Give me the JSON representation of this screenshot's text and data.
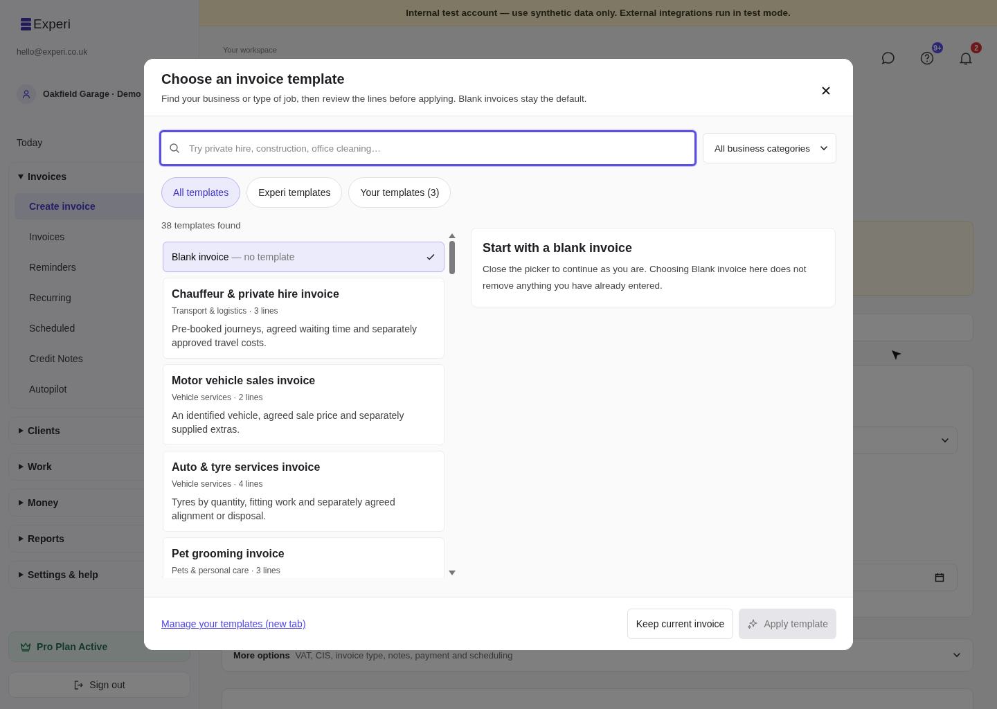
{
  "banner": {
    "text": "Internal test account — use synthetic data only. External integrations run in test mode."
  },
  "sidebar": {
    "logo": "Experi",
    "email": "hello@experi.co.uk",
    "account": "Oakfield Garage · Demo",
    "today": "Today",
    "groups": [
      {
        "label": "Invoices",
        "expanded": true,
        "items": [
          {
            "label": "Create invoice",
            "selected": true
          },
          {
            "label": "Invoices",
            "selected": false
          },
          {
            "label": "Reminders",
            "selected": false
          },
          {
            "label": "Recurring",
            "selected": false
          },
          {
            "label": "Scheduled",
            "selected": false
          },
          {
            "label": "Credit Notes",
            "selected": false
          },
          {
            "label": "Autopilot",
            "selected": false
          }
        ]
      },
      {
        "label": "Clients",
        "expanded": false
      },
      {
        "label": "Work",
        "expanded": false
      },
      {
        "label": "Money",
        "expanded": false
      },
      {
        "label": "Reports",
        "expanded": false
      },
      {
        "label": "Settings & help",
        "expanded": false
      }
    ],
    "plan": "Pro Plan Active",
    "sign_out": "Sign out"
  },
  "header": {
    "workspace": "Your workspace",
    "help_badge": "9+",
    "notifications_badge": "2"
  },
  "more_options": {
    "label": "More options",
    "hint": "VAT, CIS, invoice type, notes, payment and scheduling"
  },
  "modal": {
    "title": "Choose an invoice template",
    "subtitle": "Find your business or type of job, then review the lines before applying. Blank invoices stay the default.",
    "search": {
      "placeholder": "Try private hire, construction, office cleaning…"
    },
    "category_select": "All business categories",
    "filters": [
      {
        "label": "All templates",
        "selected": true
      },
      {
        "label": "Experi templates",
        "selected": false
      },
      {
        "label": "Your templates (3)",
        "selected": false
      }
    ],
    "count": "38 templates found",
    "templates": [
      {
        "kind": "blank",
        "label": "Blank invoice",
        "note": "— no template",
        "selected": true
      },
      {
        "kind": "template",
        "title": "Chauffeur & private hire invoice",
        "meta": "Transport & logistics · 3 lines",
        "description": "Pre-booked journeys, agreed waiting time and separately approved travel costs.",
        "selected": false
      },
      {
        "kind": "template",
        "title": "Motor vehicle sales invoice",
        "meta": "Vehicle services · 2 lines",
        "description": "An identified vehicle, agreed sale price and separately supplied extras.",
        "selected": false
      },
      {
        "kind": "template",
        "title": "Auto & tyre services invoice",
        "meta": "Vehicle services · 4 lines",
        "description": "Tyres by quantity, fitting work and separately agreed alignment or disposal.",
        "selected": false
      },
      {
        "kind": "template",
        "title": "Pet grooming invoice",
        "meta": "Pets & personal care · 3 lines",
        "selected": false
      }
    ],
    "preview": {
      "title": "Start with a blank invoice",
      "text": "Close the picker to continue as you are. Choosing Blank invoice here does not remove anything you have already entered."
    },
    "manage_link": "Manage your templates (new tab)",
    "buttons": [
      {
        "kind": "secondary",
        "label": "Keep current invoice",
        "disabled": false
      },
      {
        "kind": "primary",
        "label": "Apply template",
        "disabled": true
      }
    ]
  }
}
